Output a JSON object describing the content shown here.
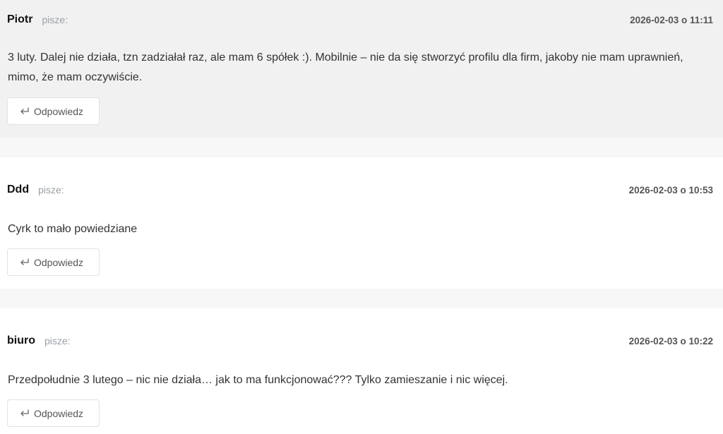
{
  "comments": [
    {
      "author": "Piotr",
      "says": "pisze:",
      "timestamp": "2026-02-03 o 11:11",
      "text": "3 luty. Dalej nie działa, tzn zadziałał raz, ale mam 6 spółek :). Mobilnie – nie da się stworzyć profilu dla firm, jakoby nie mam uprawnień, mimo, że mam oczywiście.",
      "reply_label": "Odpowiedz",
      "reply_icon": "reply-arrow-icon"
    },
    {
      "author": "Ddd",
      "says": "pisze:",
      "timestamp": "2026-02-03 o 10:53",
      "text": "Cyrk to mało powiedziane",
      "reply_label": "Odpowiedz",
      "reply_icon": "reply-arrow-icon"
    },
    {
      "author": "biuro",
      "says": "pisze:",
      "timestamp": "2026-02-03 o 10:22",
      "text": "Przedpołudnie 3 lutego – nic nie działa… jak to ma funkcjonować??? Tylko zamieszanie i nic więcej.",
      "reply_label": "Odpowiedz",
      "reply_icon": "reply-arrow-icon"
    }
  ],
  "colors": {
    "highlight_bg": "#f1f1f2",
    "comment_bg": "#ffffff",
    "page_bg": "#f7f7f7",
    "muted_text": "#9aa0a6"
  }
}
